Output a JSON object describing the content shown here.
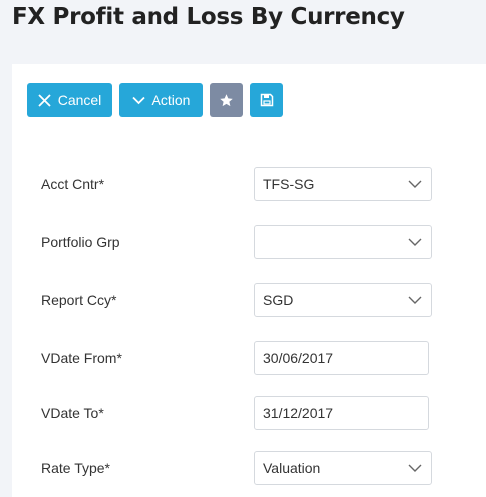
{
  "page": {
    "title": "FX Profit and Loss By Currency"
  },
  "toolbar": {
    "cancel_label": "Cancel",
    "action_label": "Action",
    "favorite_icon": "star-icon",
    "save_icon": "save-icon"
  },
  "form": {
    "acct_cntr": {
      "label": "Acct Cntr*",
      "value": "TFS-SG"
    },
    "portfolio_grp": {
      "label": "Portfolio Grp",
      "value": ""
    },
    "report_ccy": {
      "label": "Report Ccy*",
      "value": "SGD"
    },
    "vdate_from": {
      "label": "VDate From*",
      "value": "30/06/2017"
    },
    "vdate_to": {
      "label": "VDate To*",
      "value": "31/12/2017"
    },
    "rate_type": {
      "label": "Rate Type*",
      "value": "Valuation"
    }
  },
  "colors": {
    "primary": "#26a7d9",
    "secondary": "#7d8ba3",
    "background": "#f2f4f8",
    "panel": "#ffffff"
  }
}
